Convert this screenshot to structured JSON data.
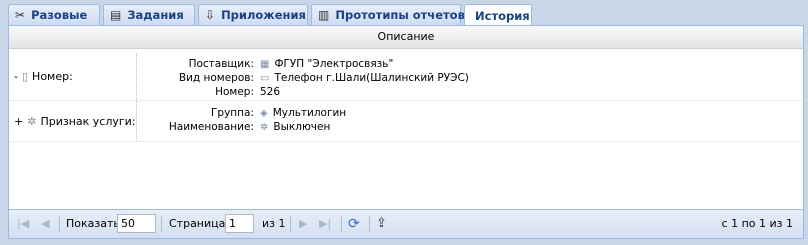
{
  "tabs": [
    {
      "label": "Разовые",
      "icon": "wrench-icon",
      "glyph": "✂"
    },
    {
      "label": "Задания",
      "icon": "task-list-icon",
      "glyph": "▤"
    },
    {
      "label": "Приложения",
      "icon": "download-box-icon",
      "glyph": "⇩"
    },
    {
      "label": "Прототипы отчетов",
      "icon": "report-icon",
      "glyph": "▥"
    },
    {
      "label": "История",
      "icon": "",
      "glyph": ""
    }
  ],
  "active_tab": "История",
  "grid": {
    "column_header": "Описание",
    "rows": [
      {
        "toggle": "-",
        "label": "Номер:",
        "fields": [
          {
            "key": "Поставщик:",
            "value": "ФГУП \"Электросвязь\"",
            "icon": "provider-icon"
          },
          {
            "key": "Вид номеров:",
            "value": "Телефон г.Шали(Шалинский РУЭС)",
            "icon": "number-type-icon"
          },
          {
            "key": "Номер:",
            "value": "526",
            "icon": ""
          }
        ]
      },
      {
        "toggle": "+",
        "label": "Признак услуги:",
        "fields": [
          {
            "key": "Группа:",
            "value": "Мультилогин",
            "icon": "group-icon"
          },
          {
            "key": "Наименование:",
            "value": "Выключен",
            "icon": "service-icon"
          }
        ]
      }
    ]
  },
  "pager": {
    "show_label": "Показать",
    "page_size": "50",
    "page_label": "Страница",
    "page": "1",
    "of_label": "из 1",
    "summary": "с 1 по 1 из 1"
  }
}
